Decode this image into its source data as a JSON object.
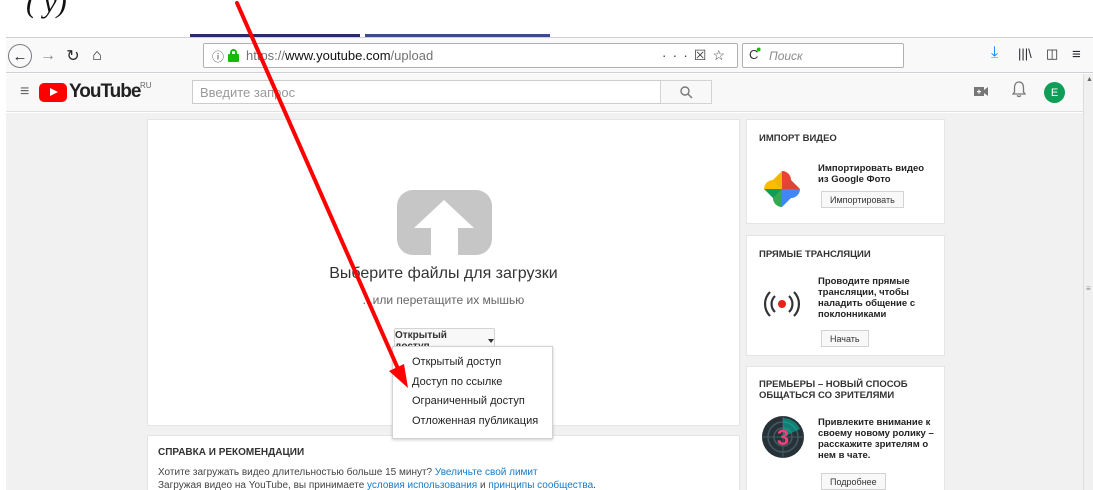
{
  "document": {
    "fragment": "(       у)"
  },
  "browser": {
    "url_host": "www.youtube.com",
    "url_prefix": "https://",
    "url_path": "/upload",
    "info_icon": "ⓘ",
    "search_placeholder": "Поиск",
    "icons": [
      "back-icon",
      "forward-icon",
      "reload-icon",
      "home-icon",
      "more-icon",
      "pocket-icon",
      "bookmark-star-icon",
      "download-icon",
      "library-icon",
      "sidebar-icon",
      "menu-icon"
    ]
  },
  "youtube": {
    "logo_text": "YouTube",
    "region": "RU",
    "search_placeholder": "Введите запрос",
    "avatar_letter": "E"
  },
  "upload": {
    "title": "Выберите файлы для загрузки",
    "subtitle": "...или перетащите их мышью",
    "privacy_selected": "Открытый доступ",
    "privacy_options": [
      "Открытый доступ",
      "Доступ по ссылке",
      "Ограниченный доступ",
      "Отложенная публикация"
    ]
  },
  "help": {
    "title": "СПРАВКА И РЕКОМЕНДАЦИИ",
    "line1_text": "Хотите загружать видео длительностью больше 15 минут?",
    "line1_link": "Увеличьте свой лимит",
    "line2_text": "Загружая видео на YouTube, вы принимаете",
    "line2_link1": "условия использования",
    "line2_and": "и",
    "line2_link2": "принципы сообщества",
    "line2_end": "."
  },
  "sidebar": {
    "import": {
      "title": "ИМПОРТ ВИДЕО",
      "text": "Импортировать видео из Google Фото",
      "button": "Импортировать"
    },
    "live": {
      "title": "ПРЯМЫЕ ТРАНСЛЯЦИИ",
      "text": "Проводите прямые трансляции, чтобы наладить общение с поклонниками",
      "button": "Начать"
    },
    "premiere": {
      "title": "ПРЕМЬЕРЫ – НОВЫЙ СПОСОБ ОБЩАТЬСЯ СО ЗРИТЕЛЯМИ",
      "text": "Привлеките внимание к своему новому ролику – расскажите зрителям о нем в чате.",
      "button": "Подробнее",
      "badge": "3"
    }
  },
  "colors": {
    "annotation_arrow": "#ff0000",
    "yt_red": "#ff0000",
    "link": "#167ac6",
    "secure": "#12bc00"
  }
}
